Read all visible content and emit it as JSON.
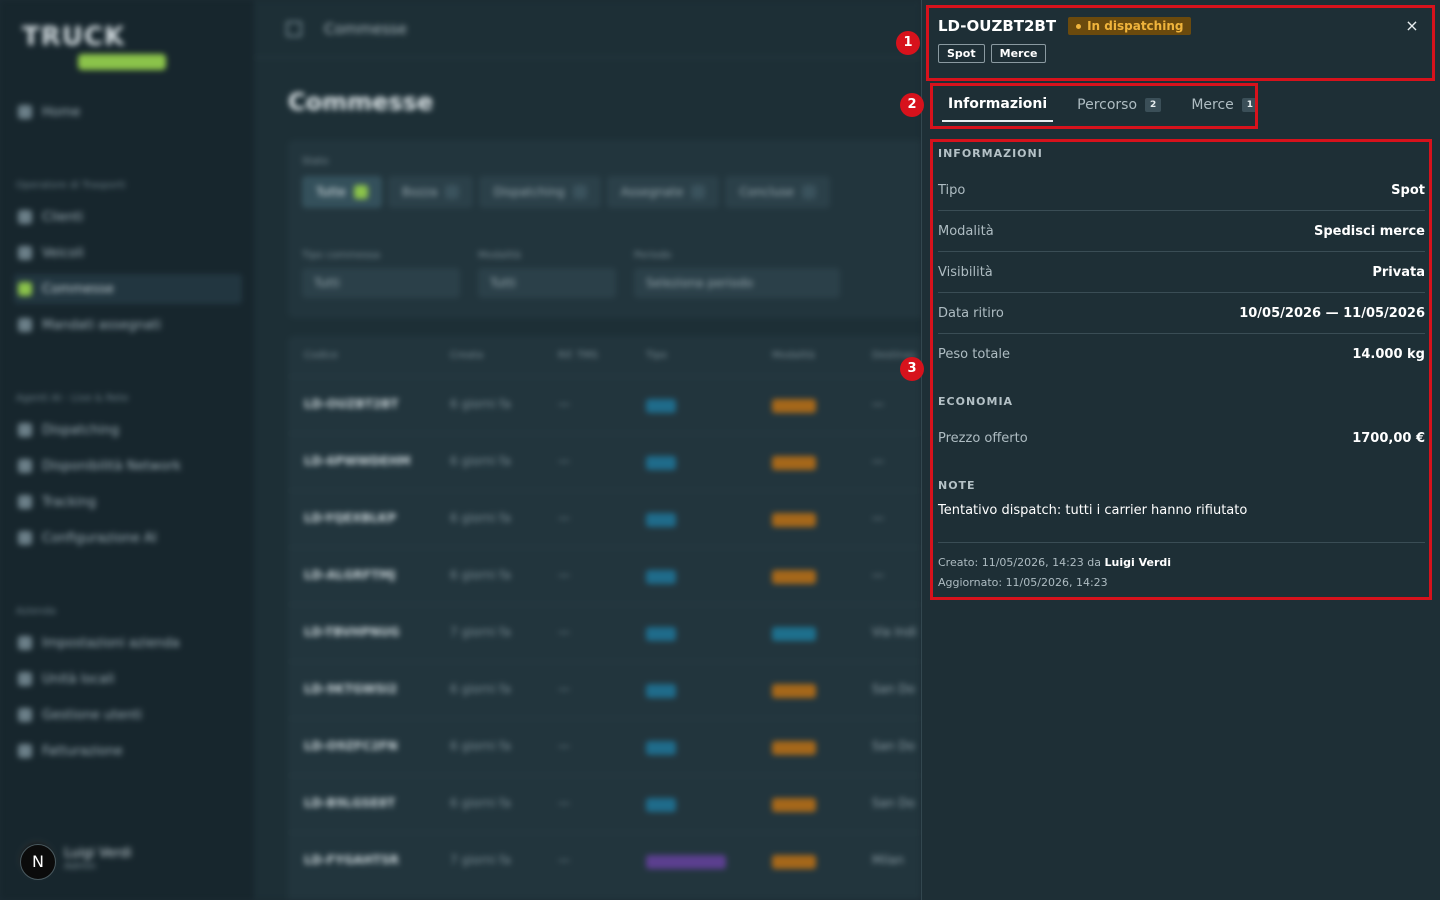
{
  "app": {
    "logo": "TRUCK"
  },
  "sidebar": {
    "home": "Home",
    "sections": [
      {
        "label": "Operatore di Trasporti",
        "items": [
          "Clienti",
          "Veicoli",
          "Commesse",
          "Mandati assegnati"
        ]
      },
      {
        "label": "Agenti AI - Live & Rete",
        "items": [
          "Dispatching",
          "Disponibilità Network",
          "Tracking",
          "Configurazione AI"
        ]
      },
      {
        "label": "Azienda",
        "items": [
          "Impostazioni azienda",
          "Unità locali",
          "Gestione utenti",
          "Fatturazione"
        ]
      }
    ],
    "user": {
      "name": "Luigi Verdi",
      "role": "Admin"
    }
  },
  "topbar": {
    "breadcrumb": "Commesse"
  },
  "page": {
    "title": "Commesse"
  },
  "filters": {
    "stato_label": "Stato",
    "chips": [
      "Tutte",
      "Bozza",
      "Dispatching",
      "Assegnate",
      "Concluse"
    ],
    "tipo_label": "Tipo commessa",
    "tipo_value": "Tutti",
    "modalita_label": "Modalità",
    "modalita_value": "Tutti",
    "periodo_label": "Periodo",
    "periodo_placeholder": "Seleziona periodo"
  },
  "table": {
    "headers": [
      "Codice",
      "Creata",
      "Rif. TMS",
      "Tipo",
      "Modalità",
      "Destinaz."
    ],
    "rows": [
      {
        "code": "LD-OUZBT2BT",
        "date": "6 giorni fa",
        "ref": "—",
        "dest": "—"
      },
      {
        "code": "LD-6PWWDEHM",
        "date": "6 giorni fa",
        "ref": "—",
        "dest": "—"
      },
      {
        "code": "LD-YQEXBLKP",
        "date": "6 giorni fa",
        "ref": "—",
        "dest": "—"
      },
      {
        "code": "LD-ALGRFTMJ",
        "date": "6 giorni fa",
        "ref": "—",
        "dest": "—"
      },
      {
        "code": "LD-TBVHPNUG",
        "date": "7 giorni fa",
        "ref": "—",
        "dest": "Via Indi"
      },
      {
        "code": "LD-9KTGWSI2",
        "date": "6 giorni fa",
        "ref": "—",
        "dest": "San Do"
      },
      {
        "code": "LD-O9ZFC2FN",
        "date": "6 giorni fa",
        "ref": "—",
        "dest": "San Do"
      },
      {
        "code": "LD-B9LGSE8T",
        "date": "6 giorni fa",
        "ref": "—",
        "dest": "San Do"
      },
      {
        "code": "LD-FYGAHTSR",
        "date": "7 giorni fa",
        "ref": "—",
        "dest": "Milan"
      }
    ]
  },
  "drawer": {
    "code": "LD-OUZBT2BT",
    "status": "In dispatching",
    "tags": [
      "Spot",
      "Merce"
    ],
    "close_icon": "×",
    "tabs": [
      {
        "label": "Informazioni",
        "count": ""
      },
      {
        "label": "Percorso",
        "count": "2"
      },
      {
        "label": "Merce",
        "count": "1"
      }
    ],
    "info": {
      "heading": "INFORMAZIONI",
      "rows": [
        {
          "label": "Tipo",
          "value": "Spot"
        },
        {
          "label": "Modalità",
          "value": "Spedisci merce"
        },
        {
          "label": "Visibilità",
          "value": "Privata"
        },
        {
          "label": "Data ritiro",
          "value": "10/05/2026 — 11/05/2026"
        },
        {
          "label": "Peso totale",
          "value": "14.000 kg"
        }
      ]
    },
    "economia": {
      "heading": "ECONOMIA",
      "label": "Prezzo offerto",
      "value": "1700,00 €"
    },
    "note": {
      "heading": "NOTE",
      "text": "Tentativo dispatch: tutti i carrier hanno rifiutato"
    },
    "meta": {
      "created_prefix": "Creato: 11/05/2026, 14:23 da",
      "created_by": "Luigi Verdi",
      "updated": "Aggiornato: 11/05/2026, 14:23"
    }
  },
  "annotations": [
    "1",
    "2",
    "3"
  ],
  "fab": {
    "label": "N"
  },
  "colors": {
    "annotation": "#d7121c",
    "status_bg": "#6b4a0d",
    "status_text": "#f0b43c",
    "accent": "#8bc34a"
  }
}
